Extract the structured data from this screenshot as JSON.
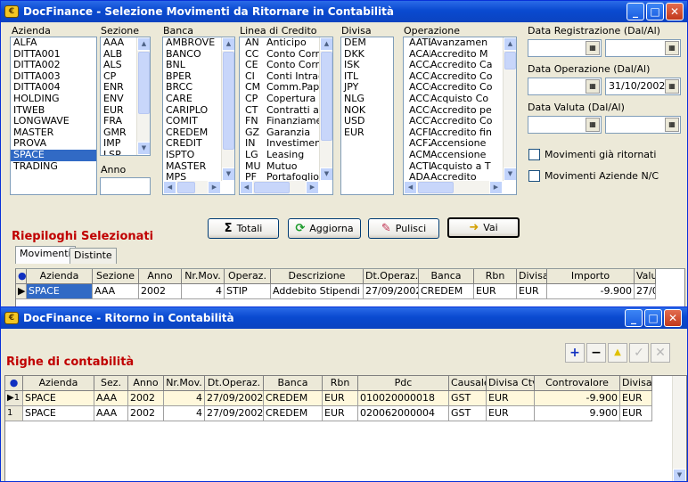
{
  "win1": {
    "title": "DocFinance - Selezione Movimenti da Ritornare in Contabilità",
    "labels": {
      "azienda": "Azienda",
      "sezione": "Sezione",
      "banca": "Banca",
      "linea": "Linea di Credito",
      "divisa": "Divisa",
      "operazione": "Operazione",
      "anno": "Anno",
      "data_reg": "Data Registrazione (Dal/Al)",
      "data_op": "Data Operazione (Dal/Al)",
      "data_val": "Data Valuta (Dal/Al)"
    },
    "aziende": [
      "ALFA",
      "DITTA001",
      "DITTA002",
      "DITTA003",
      "DITTA004",
      "HOLDING",
      "ITWEB",
      "LONGWAVE",
      "MASTER",
      "PROVA",
      "SPACE",
      "TRADING"
    ],
    "aziende_selected": "SPACE",
    "sezioni": [
      "AAA",
      "ALB",
      "ALS",
      "CP",
      "ENR",
      "ENV",
      "EUR",
      "FRA",
      "GMR",
      "IMP",
      "LSP"
    ],
    "banche": [
      "AMBROVE",
      "BANCO",
      "BNL",
      "BPER",
      "BRCC",
      "CARE",
      "CARIPLO",
      "COMIT",
      "CREDEM",
      "CREDIT",
      "ISPTO",
      "MASTER",
      "MPS"
    ],
    "linee": [
      {
        "code": "AN",
        "desc": "Anticipo"
      },
      {
        "code": "CC",
        "desc": "Conto Corr"
      },
      {
        "code": "CE",
        "desc": "Conto Corr"
      },
      {
        "code": "CI",
        "desc": "Conti Intrag"
      },
      {
        "code": "CM",
        "desc": "Comm.Pap"
      },
      {
        "code": "CP",
        "desc": "Copertura"
      },
      {
        "code": "CT",
        "desc": "Contratti a"
      },
      {
        "code": "FN",
        "desc": "Finanziame"
      },
      {
        "code": "GZ",
        "desc": "Garanzia"
      },
      {
        "code": "IN",
        "desc": "Investimen"
      },
      {
        "code": "LG",
        "desc": "Leasing"
      },
      {
        "code": "MU",
        "desc": "Mutuo"
      },
      {
        "code": "PF",
        "desc": "Portafoglio"
      }
    ],
    "divise": [
      "DEM",
      "DKK",
      "ISK",
      "ITL",
      "JPY",
      "NLG",
      "NOK",
      "USD",
      "EUR"
    ],
    "operazioni": [
      {
        "code": "AATE",
        "desc": "Avanzamen"
      },
      {
        "code": "ACAM",
        "desc": "Accredito M"
      },
      {
        "code": "ACCA",
        "desc": "Accredito Ca"
      },
      {
        "code": "ACCM",
        "desc": "Accredito Co"
      },
      {
        "code": "ACCO",
        "desc": "Accredito Co"
      },
      {
        "code": "ACCP",
        "desc": "Acquisto Co"
      },
      {
        "code": "ACCR",
        "desc": "Accredito pe"
      },
      {
        "code": "ACCT",
        "desc": "Accredito Co"
      },
      {
        "code": "ACFN",
        "desc": "Accredito fin"
      },
      {
        "code": "ACFZ",
        "desc": "Accensione"
      },
      {
        "code": "ACMU",
        "desc": "Accensione"
      },
      {
        "code": "ACTE",
        "desc": "Acquisto a T"
      },
      {
        "code": "ADAS",
        "desc": "Accredito"
      }
    ],
    "data_op_al": "31/10/2002",
    "chk_ritornati": "Movimenti già ritornati",
    "chk_aziende_nc": "Movimenti Aziende N/C",
    "buttons": {
      "totali": "Totali",
      "aggiorna": "Aggiorna",
      "pulisci": "Pulisci",
      "vai": "Vai"
    },
    "riepiloghi": "Riepiloghi Selezionati",
    "tabs": [
      "Movimenti",
      "Distinte"
    ],
    "grid_headers": [
      "",
      "Azienda",
      "Sezione",
      "Anno",
      "Nr.Mov.",
      "Operaz.",
      "Descrizione",
      "Dt.Operaz.",
      "Banca",
      "Rbn",
      "Divisa",
      "Importo",
      "Valu"
    ],
    "grid_row": [
      "",
      "SPACE",
      "AAA",
      "2002",
      "4",
      "STIP",
      "Addebito Stipendi",
      "27/09/2002",
      "CREDEM",
      "EUR",
      "EUR",
      "-9.900",
      "27/0"
    ]
  },
  "win2": {
    "title": "DocFinance - Ritorno in Contabilità",
    "heading": "Righe di contabilità",
    "grid_headers": [
      "",
      "Azienda",
      "Sez.",
      "Anno",
      "Nr.Mov.",
      "Dt.Operaz.",
      "Banca",
      "Rbn",
      "Pdc",
      "Causale",
      "Divisa Ctv",
      "Controvalore",
      "Divisa"
    ],
    "rows": [
      [
        "1",
        "SPACE",
        "AAA",
        "2002",
        "4",
        "27/09/2002",
        "CREDEM",
        "EUR",
        "010020000018",
        "GST",
        "EUR",
        "-9.900",
        "EUR"
      ],
      [
        "1",
        "SPACE",
        "AAA",
        "2002",
        "4",
        "27/09/2002",
        "CREDEM",
        "EUR",
        "020062000004",
        "GST",
        "EUR",
        "9.900",
        "EUR"
      ]
    ]
  }
}
